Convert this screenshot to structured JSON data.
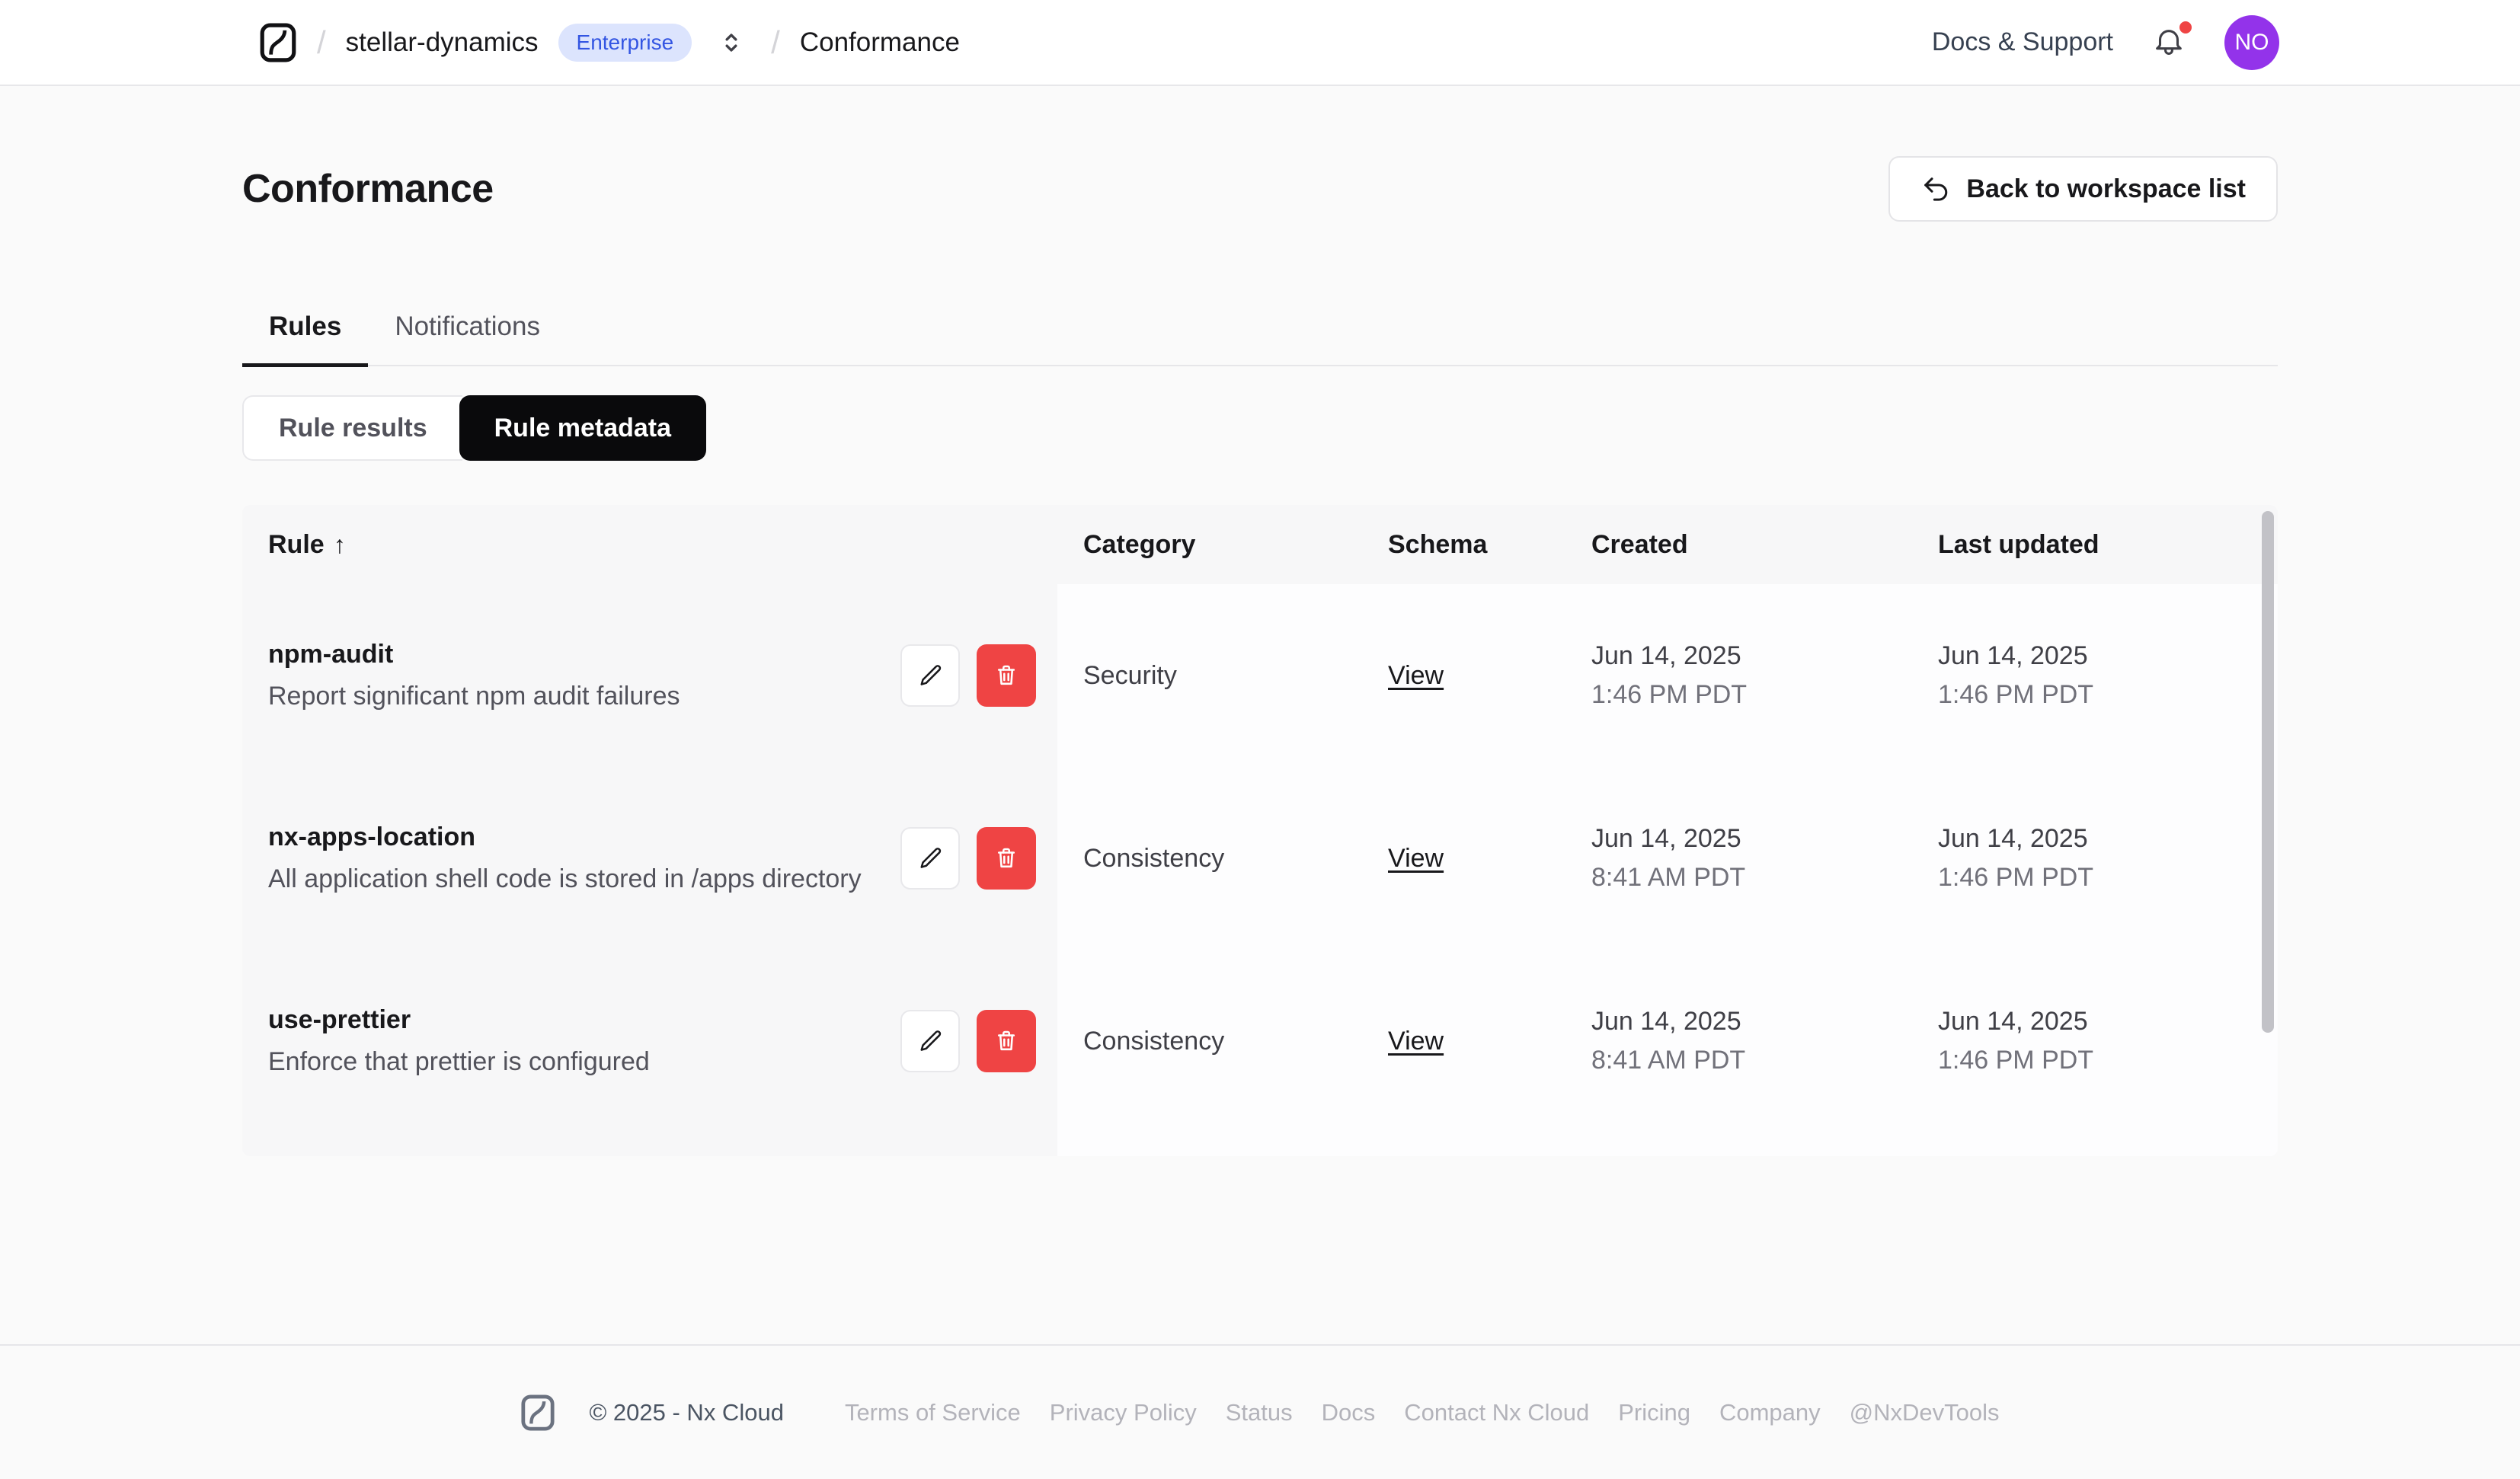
{
  "topbar": {
    "workspace": "stellar-dynamics",
    "plan_badge": "Enterprise",
    "breadcrumb_separator": "/",
    "breadcrumb_page": "Conformance",
    "docs_support_label": "Docs & Support",
    "avatar_initials": "NO",
    "icons": {
      "logo": "nx-logo",
      "switcher": "chevron-up-down-icon",
      "notifications": "bell-icon"
    }
  },
  "page": {
    "title": "Conformance",
    "back_button_label": "Back to workspace list",
    "back_button_icon": "return-arrow-icon"
  },
  "tabs": [
    {
      "label": "Rules",
      "active": true
    },
    {
      "label": "Notifications",
      "active": false
    }
  ],
  "segmented_control": [
    {
      "label": "Rule results",
      "active": false
    },
    {
      "label": "Rule metadata",
      "active": true
    }
  ],
  "table": {
    "columns": [
      "Rule",
      "Category",
      "Schema",
      "Created",
      "Last updated"
    ],
    "sort_column": "Rule",
    "sort_direction": "ascending",
    "sort_arrow": "↑",
    "row_action_icons": [
      "pencil-icon",
      "trash-icon"
    ],
    "rows": [
      {
        "name": "npm-audit",
        "description": "Report significant npm audit failures",
        "category": "Security",
        "schema_link": "View",
        "created_date": "Jun 14, 2025",
        "created_time": "1:46 PM PDT",
        "updated_date": "Jun 14, 2025",
        "updated_time": "1:46 PM PDT"
      },
      {
        "name": "nx-apps-location",
        "description": "All application shell code is stored in /apps directory",
        "category": "Consistency",
        "schema_link": "View",
        "created_date": "Jun 14, 2025",
        "created_time": "8:41 AM PDT",
        "updated_date": "Jun 14, 2025",
        "updated_time": "1:46 PM PDT"
      },
      {
        "name": "use-prettier",
        "description": "Enforce that prettier is configured",
        "category": "Consistency",
        "schema_link": "View",
        "created_date": "Jun 14, 2025",
        "created_time": "8:41 AM PDT",
        "updated_date": "Jun 14, 2025",
        "updated_time": "1:46 PM PDT"
      }
    ]
  },
  "footer": {
    "copyright": "© 2025 - Nx Cloud",
    "links": [
      "Terms of Service",
      "Privacy Policy",
      "Status",
      "Docs",
      "Contact Nx Cloud",
      "Pricing",
      "Company",
      "@NxDevTools"
    ]
  },
  "colors": {
    "page_background": "#FAFAFA",
    "badge_background": "#DCE4FD",
    "badge_text": "#3355E2",
    "danger": "#EF4444",
    "avatar_background": "#9333EA",
    "active_segment_background": "#0A0A0C",
    "table_shade": "#F7F7F8"
  }
}
